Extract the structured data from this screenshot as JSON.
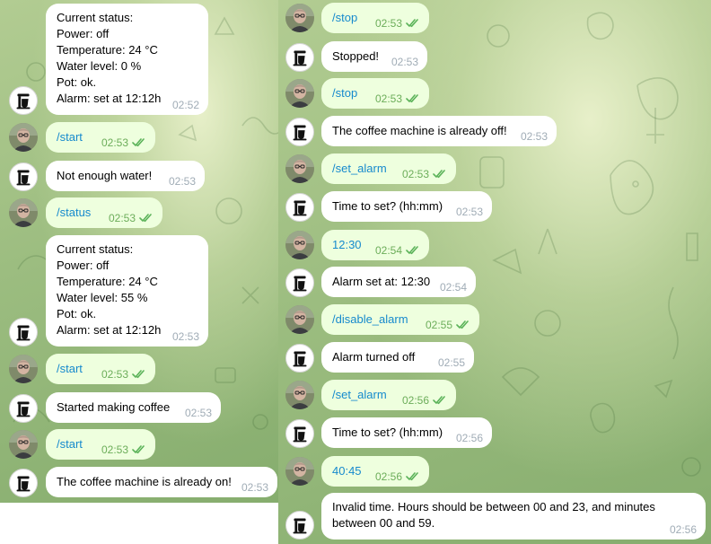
{
  "left_messages": [
    {
      "sender": "bot",
      "lines": [
        "Current status:",
        "Power: off",
        "Temperature: 24 °C",
        "Water level: 0 %",
        "Pot: ok.",
        "Alarm: set at 12:12h"
      ],
      "time": "02:52"
    },
    {
      "sender": "user",
      "text": "/start",
      "time": "02:53"
    },
    {
      "sender": "bot",
      "text": "Not enough water!",
      "time": "02:53"
    },
    {
      "sender": "user",
      "text": "/status",
      "time": "02:53"
    },
    {
      "sender": "bot",
      "lines": [
        "Current status:",
        "Power: off",
        "Temperature: 24 °C",
        "Water level: 55 %",
        "Pot: ok.",
        "Alarm: set at 12:12h"
      ],
      "time": "02:53"
    },
    {
      "sender": "user",
      "text": "/start",
      "time": "02:53"
    },
    {
      "sender": "bot",
      "text": "Started making coffee",
      "time": "02:53"
    },
    {
      "sender": "user",
      "text": "/start",
      "time": "02:53"
    },
    {
      "sender": "bot",
      "text": "The coffee machine is already on!",
      "time": "02:53"
    }
  ],
  "right_messages": [
    {
      "sender": "user",
      "text": "/stop",
      "time": "02:53"
    },
    {
      "sender": "bot",
      "text": "Stopped!",
      "time": "02:53"
    },
    {
      "sender": "user",
      "text": "/stop",
      "time": "02:53"
    },
    {
      "sender": "bot",
      "text": "The coffee machine is already off!",
      "time": "02:53"
    },
    {
      "sender": "user",
      "text": "/set_alarm",
      "time": "02:53"
    },
    {
      "sender": "bot",
      "text": "Time to set? (hh:mm)",
      "time": "02:53"
    },
    {
      "sender": "user",
      "text": "12:30",
      "time": "02:54"
    },
    {
      "sender": "bot",
      "text": "Alarm set at: 12:30",
      "time": "02:54"
    },
    {
      "sender": "user",
      "text": "/disable_alarm",
      "time": "02:55"
    },
    {
      "sender": "bot",
      "text": "Alarm turned off",
      "time": "02:55"
    },
    {
      "sender": "user",
      "text": "/set_alarm",
      "time": "02:56"
    },
    {
      "sender": "bot",
      "text": "Time to set? (hh:mm)",
      "time": "02:56"
    },
    {
      "sender": "user",
      "text": "40:45",
      "time": "02:56"
    },
    {
      "sender": "bot",
      "lines": [
        "Invalid time. Hours should be between 00 and 23, and minutes",
        "between 00 and 59."
      ],
      "time": "02:56"
    }
  ],
  "colors": {
    "incoming_bubble": "#ffffff",
    "outgoing_bubble": "#eeffde",
    "command_text": "#168acd",
    "read_check": "#5cb35a",
    "chat_background": "#9cbd80"
  },
  "icons": {
    "bot_avatar": "coffee-machine-icon",
    "user_avatar": "user-photo-avatar",
    "read_receipt": "double-check-icon"
  }
}
